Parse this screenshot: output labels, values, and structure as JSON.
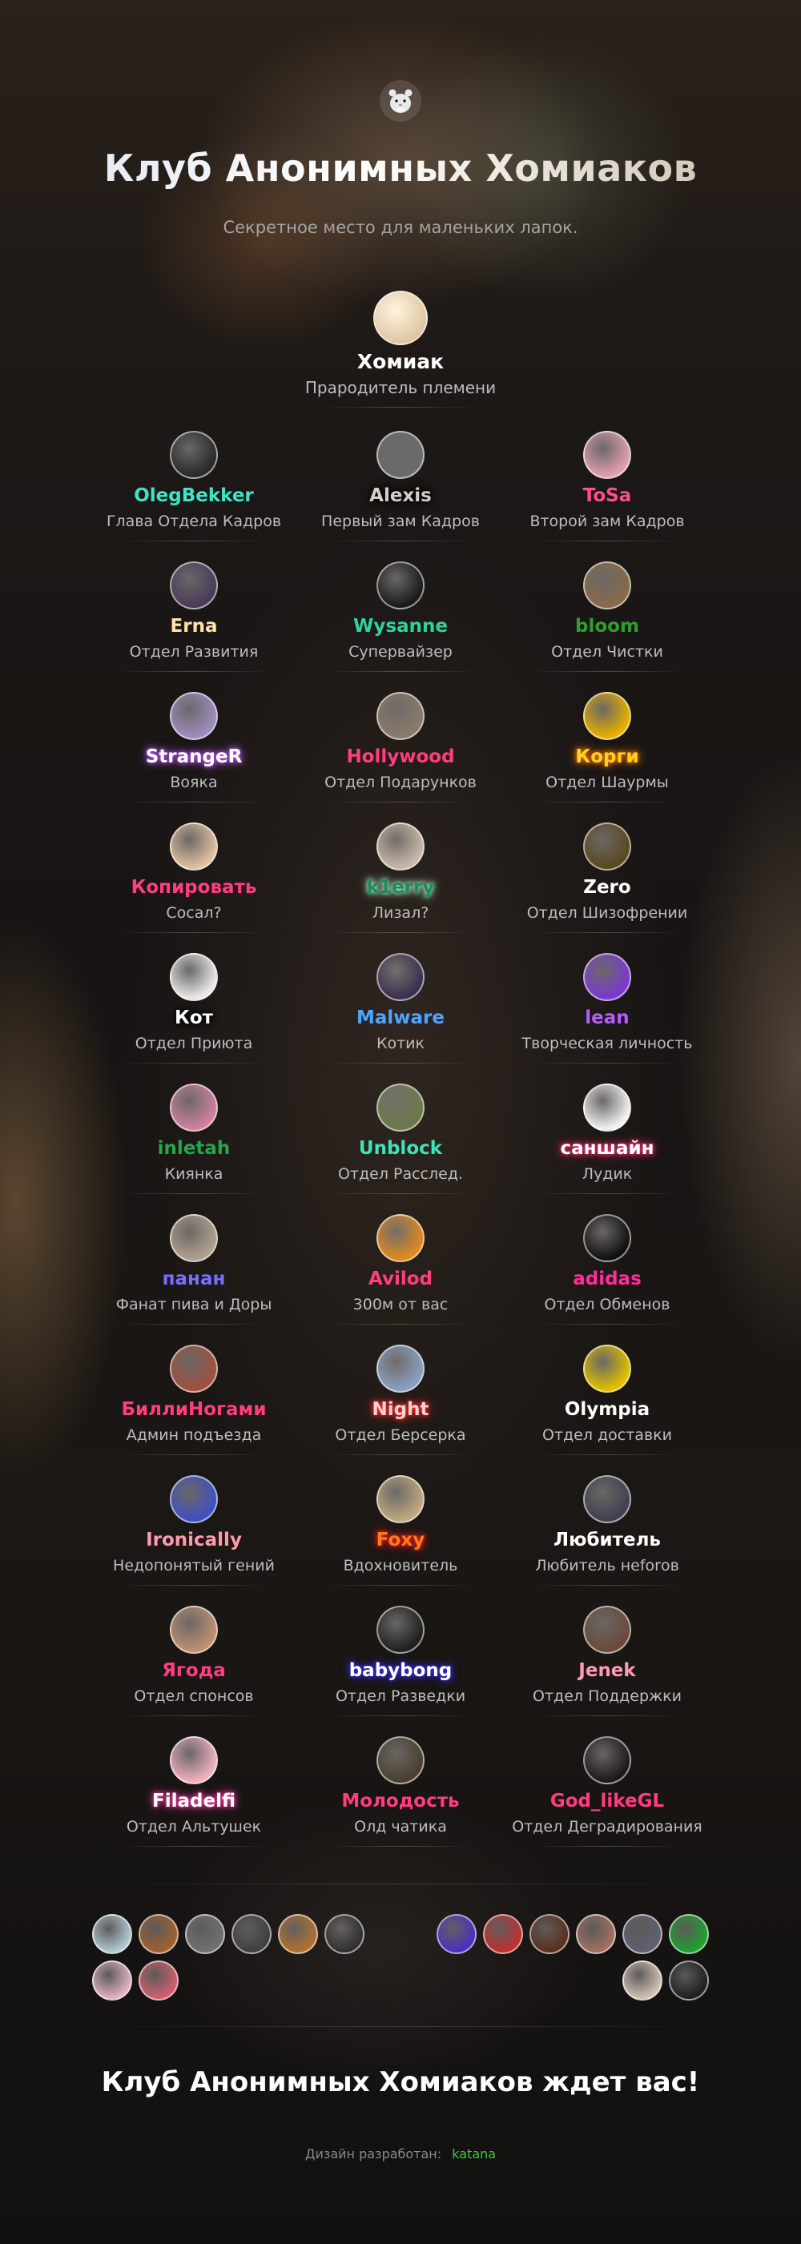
{
  "header": {
    "title": "Клуб Анонимных Хомиаков",
    "subtitle": "Секретное место для маленьких лапок.",
    "logo_icon": "hamster-icon"
  },
  "founder": {
    "nick": "Хомиак",
    "role": "Прародитель племени",
    "nick_color": "#ffffff",
    "avatar_color": "#d2b48c"
  },
  "members": [
    {
      "nick": "OlegBekker",
      "role": "Глава Отдела Кадров",
      "nick_color": "#3fe3c8",
      "glow": "",
      "avatar_color": "#2a2a2a"
    },
    {
      "nick": "Alexis",
      "role": "Первый зам Кадров",
      "nick_color": "#cfcfcf",
      "glow": "#000000",
      "avatar_color": "#6b6b6b"
    },
    {
      "nick": "ToSa",
      "role": "Второй зам Кадров",
      "nick_color": "#ff4f86",
      "glow": "",
      "avatar_color": "#e0a0b0"
    },
    {
      "nick": "Erna",
      "role": "Отдел Развития",
      "nick_color": "#ffe2a6",
      "glow": "",
      "avatar_color": "#4a3b5a"
    },
    {
      "nick": "Wysanne",
      "role": "Супервайзер",
      "nick_color": "#2fd39b",
      "glow": "",
      "avatar_color": "#1a1a1a"
    },
    {
      "nick": "bloom",
      "role": "Отдел Чистки",
      "nick_color": "#2f9e2c",
      "glow": "",
      "avatar_color": "#8a6a4a"
    },
    {
      "nick": "StrangeR",
      "role": "Воякa",
      "nick_color": "#ffffff",
      "glow": "#c05bff",
      "avatar_color": "#a08cc0"
    },
    {
      "nick": "Hollywood",
      "role": "Отдел Подарунков",
      "nick_color": "#ff3d7f",
      "glow": "",
      "avatar_color": "#8a7a6a"
    },
    {
      "nick": "Корги",
      "role": "Отдел Шаурмы",
      "nick_color": "#ffd21e",
      "glow": "#ff7a00",
      "avatar_color": "#e8b000"
    },
    {
      "nick": "Копировать",
      "role": "Сосал?",
      "nick_color": "#ff3d7f",
      "glow": "",
      "avatar_color": "#e0c0a0"
    },
    {
      "nick": "k1erry",
      "role": "Лизал?",
      "nick_color": "#1d8c56",
      "glow": "#b9ffd9",
      "avatar_color": "#c8b8a8"
    },
    {
      "nick": "Zero",
      "role": "Отдел Шизофрении",
      "nick_color": "#ffffff",
      "glow": "",
      "avatar_color": "#5a4a20"
    },
    {
      "nick": "Кот",
      "role": "Отдел Приюта",
      "nick_color": "#ffffff",
      "glow": "#000000",
      "avatar_color": "#e8e8e8"
    },
    {
      "nick": "Malware",
      "role": "Котик",
      "nick_color": "#4fa3ff",
      "glow": "",
      "avatar_color": "#3a3050"
    },
    {
      "nick": "lean",
      "role": "Творческая личность",
      "nick_color": "#b65cff",
      "glow": "",
      "avatar_color": "#7a3ad0"
    },
    {
      "nick": "inletah",
      "role": "Киянка",
      "nick_color": "#23a84a",
      "glow": "",
      "avatar_color": "#d080a0"
    },
    {
      "nick": "Unblock",
      "role": "Отдел Расслед.",
      "nick_color": "#3fe3b8",
      "glow": "",
      "avatar_color": "#6a7a4a"
    },
    {
      "nick": "саншайн",
      "role": "Лудик",
      "nick_color": "#ffffff",
      "glow": "#ff2d6f",
      "avatar_color": "#f0f0f0"
    },
    {
      "nick": "панан",
      "role": "Фанат пива и Доры",
      "nick_color": "#7a6dff",
      "glow": "",
      "avatar_color": "#b0a090"
    },
    {
      "nick": "Avilod",
      "role": "300м от вас",
      "nick_color": "#ff3d7f",
      "glow": "",
      "avatar_color": "#e08a20"
    },
    {
      "nick": "adidas",
      "role": "Отдел Обменов",
      "nick_color": "#ff2d9a",
      "glow": "",
      "avatar_color": "#101010"
    },
    {
      "nick": "БиллиНогами",
      "role": "Админ подъезда",
      "nick_color": "#ff3d7f",
      "glow": "",
      "avatar_color": "#a05040"
    },
    {
      "nick": "Night",
      "role": "Отдел Берсерка",
      "nick_color": "#ffd0d0",
      "glow": "#ff2b2b",
      "avatar_color": "#8aa0c0"
    },
    {
      "nick": "Olympia",
      "role": "Отдел доставки",
      "nick_color": "#ffffff",
      "glow": "",
      "avatar_color": "#e0c000"
    },
    {
      "nick": "Ironically",
      "role": "Недопонятый гений",
      "nick_color": "#ff9ab0",
      "glow": "",
      "avatar_color": "#4050c0"
    },
    {
      "nick": "Foxy",
      "role": "Вдохновитель",
      "nick_color": "#ff7a1a",
      "glow": "#ff2020",
      "avatar_color": "#c0a880"
    },
    {
      "nick": "Любитель",
      "role": "Любитель неforов",
      "nick_color": "#ffffff",
      "glow": "",
      "avatar_color": "#404050"
    },
    {
      "nick": "Ягода",
      "role": "Отдел спонсов",
      "nick_color": "#ff3d7f",
      "glow": "",
      "avatar_color": "#c09070"
    },
    {
      "nick": "babybong",
      "role": "Отдел Разведки",
      "nick_color": "#ffffff",
      "glow": "#3a2cff",
      "avatar_color": "#202020"
    },
    {
      "nick": "Jenek",
      "role": "Отдел Поддержки",
      "nick_color": "#ff9ab8",
      "glow": "",
      "avatar_color": "#6a4a3a"
    },
    {
      "nick": "Filadelfi",
      "role": "Отдел Альтушек",
      "nick_color": "#ffffff",
      "glow": "#ff3da8",
      "avatar_color": "#f0b0c0"
    },
    {
      "nick": "Молодость",
      "role": "Олд чатика",
      "nick_color": "#ff3d7f",
      "glow": "",
      "avatar_color": "#4a4030"
    },
    {
      "nick": "God_likeGL",
      "role": "Отдел Деградирования",
      "nick_color": "#ff3d7f",
      "glow": "",
      "avatar_color": "#201818"
    }
  ],
  "avatar_strip_left": [
    "#b0c8d0",
    "#a06030",
    "#707070",
    "#404040",
    "#b07030",
    "#303030",
    "#e0b0c0",
    "#d06070"
  ],
  "avatar_strip_right": [
    "#4a30c0",
    "#c03030",
    "#5a3020",
    "#a07060",
    "#606070",
    "#20a030",
    "#d0c0b0",
    "#202020"
  ],
  "footer": {
    "title": "Клуб Анонимных Хомиаков ждет вас!",
    "credit_label": "Дизайн разработан:",
    "credit_name": "katana"
  }
}
